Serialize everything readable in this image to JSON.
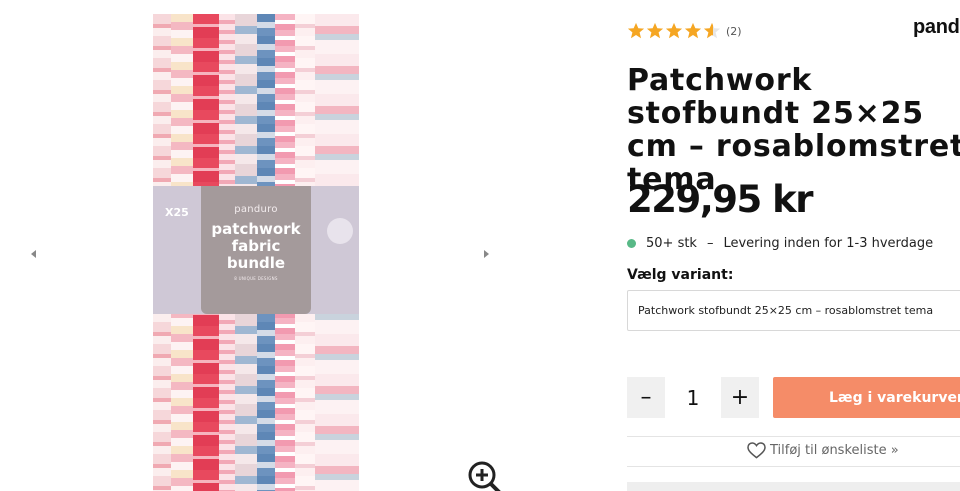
{
  "gallery": {
    "prev_icon": "chevron-left-icon",
    "next_icon": "chevron-right-icon",
    "zoom_icon": "zoom-in-icon",
    "image": {
      "count_label": "X25",
      "brand": "panduro",
      "title_line1": "patchwork",
      "title_line2": "fabric bundle",
      "subtitle": "8 UNIQUE DESIGNS"
    }
  },
  "product": {
    "rating": {
      "stars": 4.5,
      "max": 5,
      "count": "(2)",
      "star_color": "#f5a623"
    },
    "brand_logo": "panduro",
    "title": "Patchwork stofbundt 25×25 cm – rosablomstret tema",
    "price": "229,95 kr",
    "stock": {
      "count": "50+ stk",
      "separator": "–",
      "delivery": "Levering inden for 1-3 hverdage",
      "dot_color": "#58b987"
    },
    "variant": {
      "label": "Vælg variant:",
      "selected": "Patchwork stofbundt 25×25 cm – rosablomstret tema"
    },
    "quantity": {
      "minus": "–",
      "value": "1",
      "plus": "+"
    },
    "add_to_cart": {
      "label": "Læg i varekurven",
      "color": "#f58c68"
    },
    "wishlist": {
      "label": "Tilføj til ønskeliste »",
      "icon": "heart-icon"
    }
  }
}
